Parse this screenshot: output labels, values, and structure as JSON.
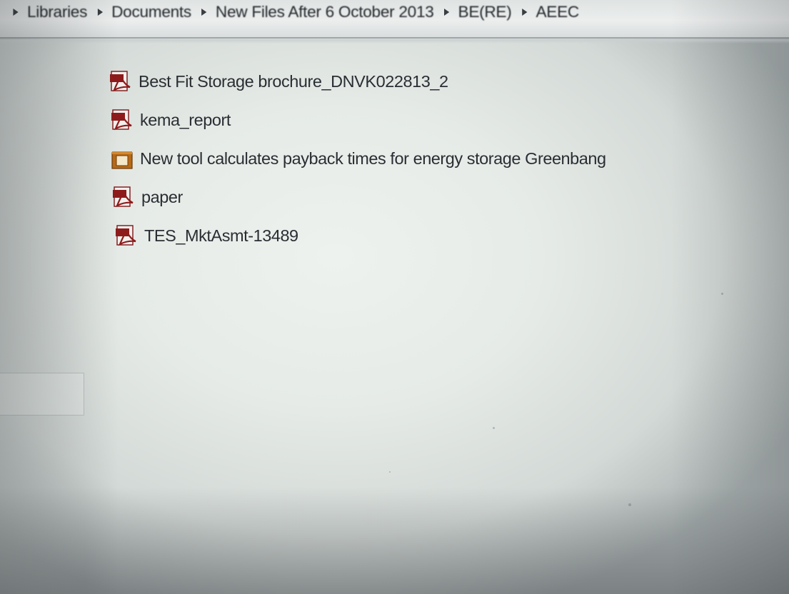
{
  "breadcrumb": {
    "items": [
      "Libraries",
      "Documents",
      "New Files After 6 October 2013",
      "BE(RE)",
      "AEEC"
    ]
  },
  "files": [
    {
      "name": "Best Fit Storage brochure_DNVK022813_2",
      "icon": "pdf-icon"
    },
    {
      "name": "kema_report",
      "icon": "pdf-icon"
    },
    {
      "name": "New tool calculates payback times for energy storage  Greenbang",
      "icon": "archive-icon"
    },
    {
      "name": "paper",
      "icon": "pdf-icon"
    },
    {
      "name": "TES_MktAsmt-13489",
      "icon": "pdf-icon"
    }
  ],
  "colors": {
    "pdf_icon": "#8e1b1b",
    "archive_icon": "#b86a18",
    "text": "#2a2e33"
  }
}
